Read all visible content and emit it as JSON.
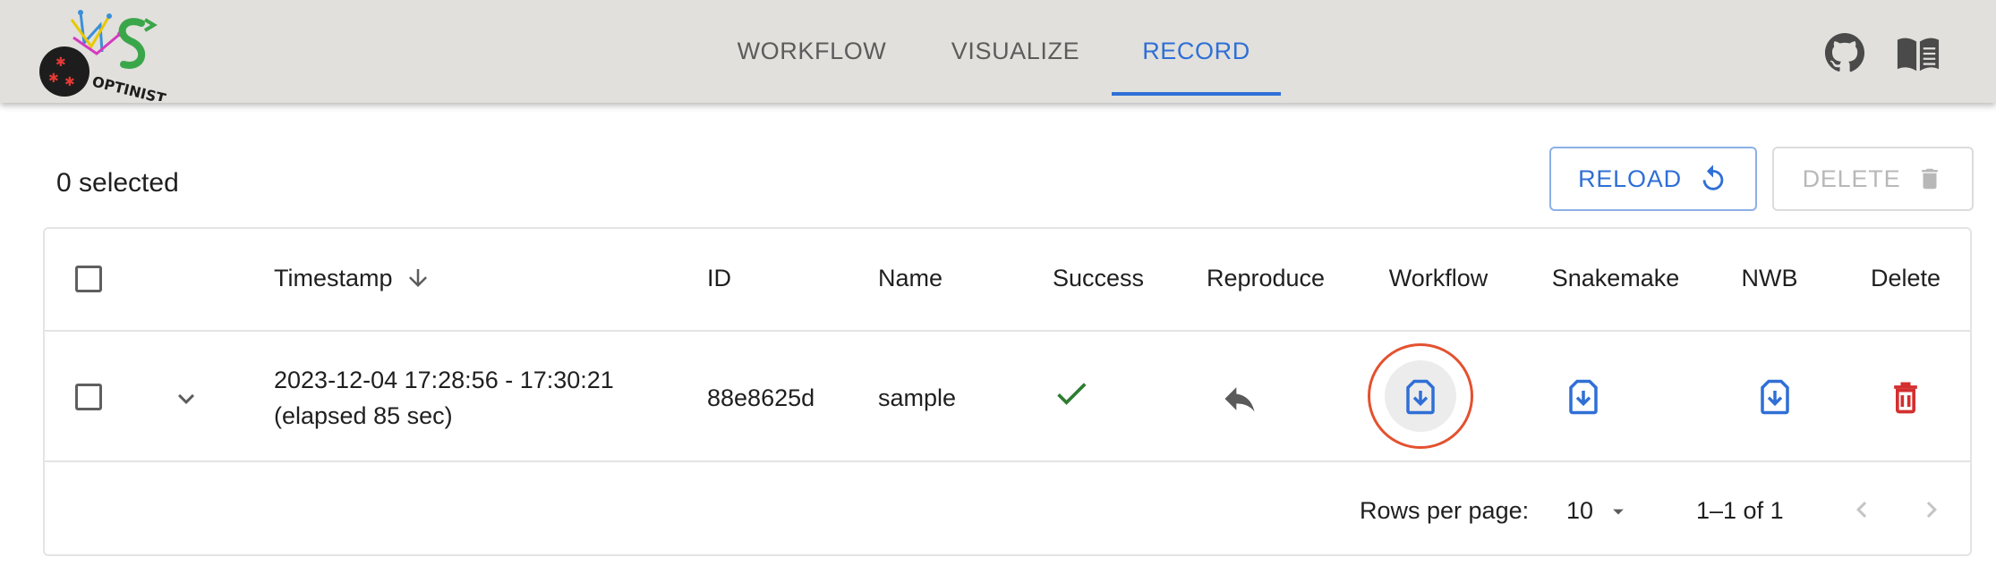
{
  "app": {
    "logo_text": "OPTINIST",
    "nav_tabs": [
      {
        "label": "WORKFLOW",
        "active": false
      },
      {
        "label": "VISUALIZE",
        "active": false
      },
      {
        "label": "RECORD",
        "active": true
      }
    ],
    "icons": [
      "github-icon",
      "book-icon"
    ],
    "accent_color": "#2f6fd6",
    "bar_color": "#e1e0dc"
  },
  "toolbar": {
    "selected_text": "0 selected",
    "reload_label": "RELOAD",
    "delete_label": "DELETE"
  },
  "table": {
    "columns": [
      "Timestamp",
      "ID",
      "Name",
      "Success",
      "Reproduce",
      "Workflow",
      "Snakemake",
      "NWB",
      "Delete"
    ],
    "sort": {
      "column": "Timestamp",
      "direction": "descending"
    },
    "rows": [
      {
        "timestamp": "2023-12-04 17:28:56 - 17:30:21",
        "elapsed": "(elapsed 85 sec)",
        "id": "88e8625d",
        "name": "sample",
        "success": true
      }
    ]
  },
  "pagination": {
    "rows_per_page_label": "Rows per page:",
    "rows_per_page_value": "10",
    "range_text": "1–1 of 1"
  },
  "colors": {
    "success": "#2e7d32",
    "download": "#2f6fd6",
    "delete": "#d32f2f",
    "highlight_ring": "#e4512f"
  }
}
